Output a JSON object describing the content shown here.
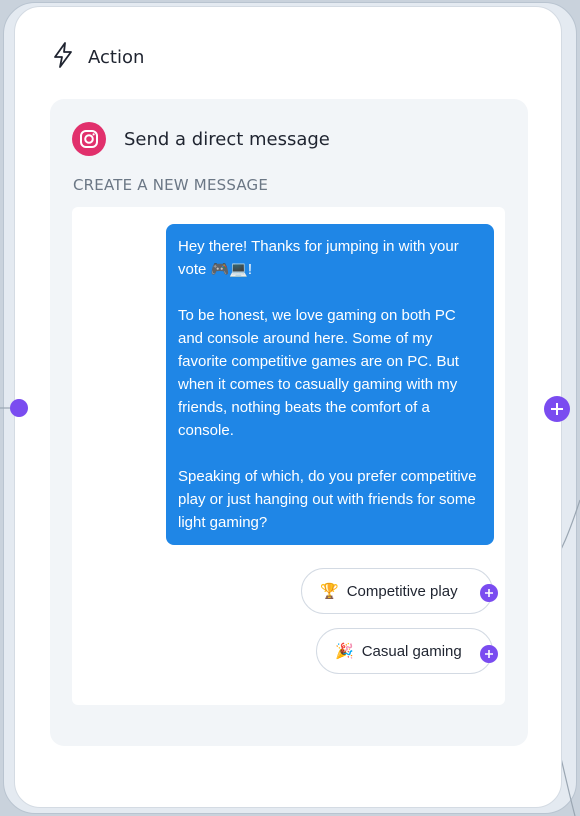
{
  "action": {
    "title": "Action",
    "icon": "lightning-icon"
  },
  "step": {
    "title": "Send a direct message",
    "icon": "instagram-icon",
    "section_label": "CREATE A NEW MESSAGE"
  },
  "message": {
    "text": "Hey there! Thanks for jumping in with your vote 🎮💻!\n\nTo be honest, we love gaming on both PC and console around here. Some of my favorite competitive games are on PC. But when it comes to casually gaming with my friends, nothing beats the comfort of a console.\n\nSpeaking of which, do you prefer competitive play or just hanging out with friends for some light gaming?"
  },
  "buttons": [
    {
      "emoji": "🏆",
      "label": "Competitive play"
    },
    {
      "emoji": "🎉",
      "label": "Casual gaming"
    }
  ],
  "colors": {
    "accent": "#7a4cf0",
    "bubble": "#1f86e6",
    "instagram": "#e1306c"
  }
}
